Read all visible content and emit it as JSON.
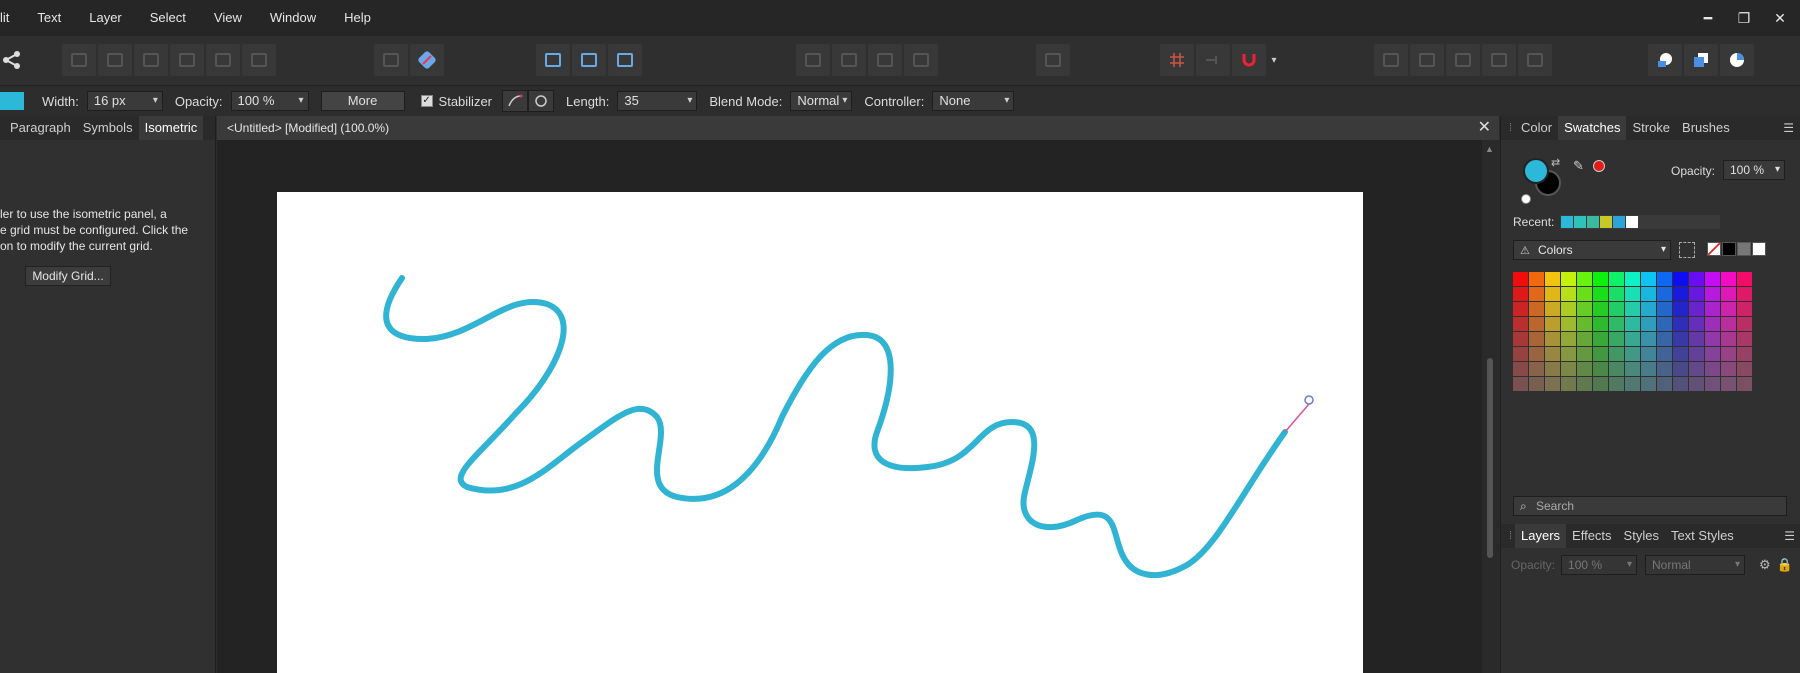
{
  "menu": {
    "items": [
      "lit",
      "Text",
      "Layer",
      "Select",
      "View",
      "Window",
      "Help"
    ]
  },
  "window_controls": {
    "minimize": "━",
    "restore": "❐",
    "close": "✕"
  },
  "context_bar": {
    "width_label": "Width:",
    "width_value": "16 px",
    "opacity_label": "Opacity:",
    "opacity_value": "100 %",
    "more_label": "More",
    "stabilizer_label": "Stabilizer",
    "stabilizer_checked": "✓",
    "length_label": "Length:",
    "length_value": "35",
    "blend_label": "Blend Mode:",
    "blend_value": "Normal",
    "controller_label": "Controller:",
    "controller_value": "None",
    "brush_color": "#2cb8d8"
  },
  "left_panel": {
    "tabs": [
      "Paragraph",
      "Symbols",
      "Isometric"
    ],
    "message_lines": [
      "ler to use the isometric panel, a",
      "e grid must be configured. Click the",
      "on to modify the current grid."
    ],
    "modify_button": "Modify Grid..."
  },
  "document": {
    "title": "<Untitled> [Modified] (100.0%)",
    "close": "✕",
    "stroke_color": "#31b4d4"
  },
  "right_panel": {
    "tabs": [
      "Color",
      "Swatches",
      "Stroke",
      "Brushes"
    ],
    "menu_glyph": "☰",
    "opacity_label": "Opacity:",
    "opacity_value": "100 %",
    "recent_label": "Recent:",
    "recent_colors": [
      "#2cb8d8",
      "#2fc2b8",
      "#3bb8a0",
      "#c8c82a",
      "#2ca4d8",
      "#ffffff"
    ],
    "palette_name": "Colors",
    "search_placeholder": "Search",
    "layers_tabs": [
      "Layers",
      "Effects",
      "Styles",
      "Text Styles"
    ],
    "layers_opacity_label": "Opacity:",
    "layers_opacity_value": "100 %",
    "layers_blend_value": "Normal"
  }
}
